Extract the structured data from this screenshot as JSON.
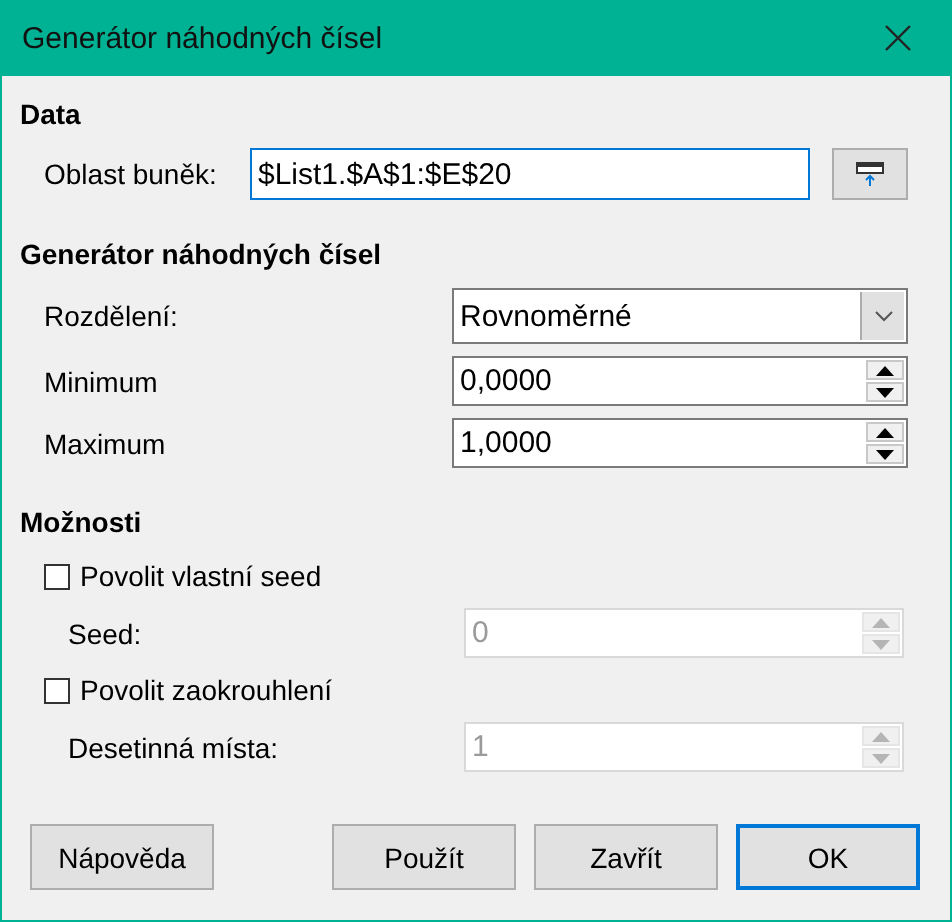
{
  "window": {
    "title": "Generátor náhodných čísel"
  },
  "sections": [
    {
      "heading": "Data",
      "rows": [
        {
          "kind": "range",
          "label": "Oblast buněk:",
          "value": "$List1.$A$1:$E$20",
          "focused": true
        }
      ]
    },
    {
      "heading": "Generátor náhodných čísel",
      "rows": [
        {
          "kind": "select",
          "label": "Rozdělení:",
          "value": "Rovnoměrné"
        },
        {
          "kind": "spin",
          "label": "Minimum",
          "value": "0,0000",
          "disabled": false
        },
        {
          "kind": "spin",
          "label": "Maximum",
          "value": "1,0000",
          "disabled": false
        }
      ]
    },
    {
      "heading": "Možnosti",
      "rows": [
        {
          "kind": "checkbox",
          "label": "Povolit vlastní seed",
          "checked": false
        },
        {
          "kind": "spin",
          "label": "Seed:",
          "value": "0",
          "disabled": true
        },
        {
          "kind": "checkbox",
          "label": "Povolit zaokrouhlení",
          "checked": false
        },
        {
          "kind": "spin",
          "label": "Desetinná místa:",
          "value": "1",
          "disabled": true
        }
      ]
    }
  ],
  "buttons": [
    {
      "label": "Nápověda",
      "default": false
    },
    {
      "label": "Použít",
      "default": false
    },
    {
      "label": "Zavřít",
      "default": false
    },
    {
      "label": "OK",
      "default": true
    }
  ]
}
